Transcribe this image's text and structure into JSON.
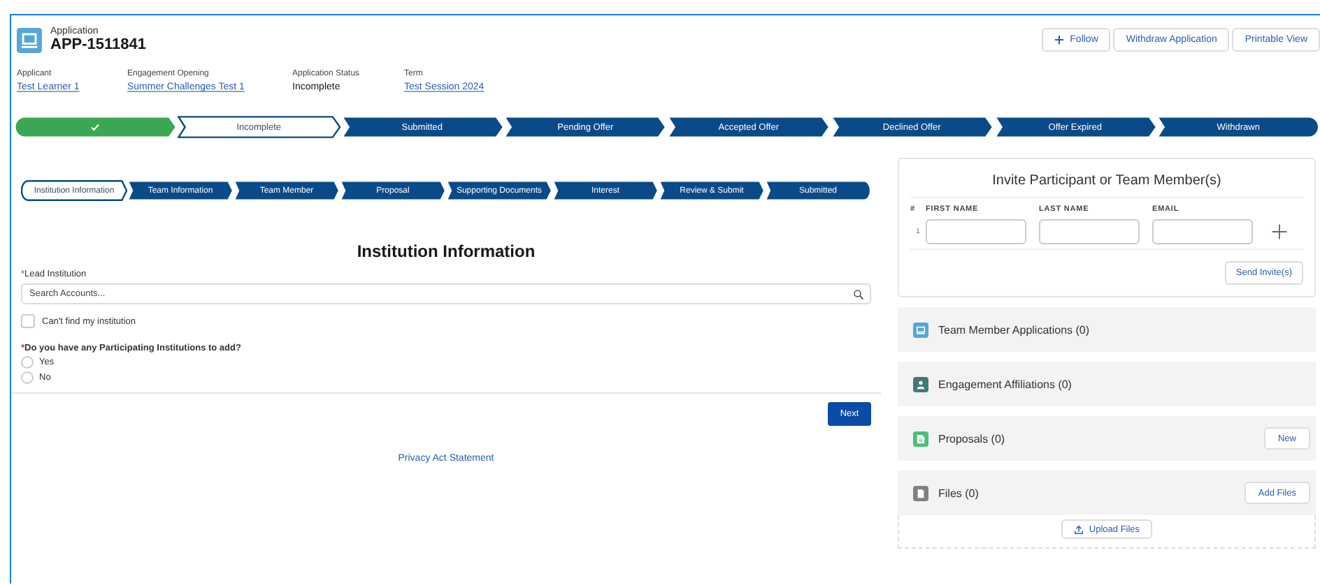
{
  "header": {
    "object_type": "Application",
    "record_name": "APP-1511841",
    "actions": [
      {
        "label": "Follow",
        "kind": "follow"
      },
      {
        "label": "Withdraw Application",
        "kind": "plain"
      },
      {
        "label": "Printable View",
        "kind": "plain"
      }
    ],
    "fields": [
      {
        "label": "Applicant",
        "value": "Test Learner 1",
        "link": true
      },
      {
        "label": "Engagement Opening",
        "value": "Summer Challenges Test 1",
        "link": true
      },
      {
        "label": "Application Status",
        "value": "Incomplete",
        "link": false
      },
      {
        "label": "Term",
        "value": "Test Session 2024",
        "link": true
      }
    ]
  },
  "status_path": [
    {
      "completed": true,
      "selected": false
    },
    {
      "label": "Incomplete",
      "completed": false,
      "selected": true
    },
    {
      "label": "Submitted",
      "completed": false,
      "selected": false
    },
    {
      "label": "Pending Offer",
      "completed": false,
      "selected": false
    },
    {
      "label": "Accepted Offer",
      "completed": false,
      "selected": false
    },
    {
      "label": "Declined Offer",
      "completed": false,
      "selected": false
    },
    {
      "label": "Offer Expired",
      "completed": false,
      "selected": false
    },
    {
      "label": "Withdrawn",
      "completed": false,
      "selected": false
    }
  ],
  "form_steps": [
    {
      "label": "Institution Information",
      "completed": false,
      "selected": true
    },
    {
      "label": "Team Information",
      "completed": false,
      "selected": false
    },
    {
      "label": "Team Member",
      "completed": false,
      "selected": false
    },
    {
      "label": "Proposal",
      "completed": false,
      "selected": false
    },
    {
      "label": "Supporting Documents",
      "completed": false,
      "selected": false
    },
    {
      "label": "Interest",
      "completed": false,
      "selected": false
    },
    {
      "label": "Review & Submit",
      "completed": false,
      "selected": false
    },
    {
      "label": "Submitted",
      "completed": false,
      "selected": false
    }
  ],
  "form": {
    "title": "Institution Information",
    "lead_institution": {
      "label": "Lead Institution",
      "required_mark": "*",
      "placeholder": "Search Accounts..."
    },
    "checkbox": {
      "label": "Can't find my institution",
      "checked": false
    },
    "question": {
      "label": "Do you have any Participating Institutions to add?",
      "required_mark": "*"
    },
    "options": [
      {
        "label": "Yes",
        "selected": false
      },
      {
        "label": "No",
        "selected": false
      }
    ],
    "next_button": "Next",
    "footer_link": "Privacy Act Statement"
  },
  "invite": {
    "title": "Invite Participant or Team Member(s)",
    "columns": [
      "#",
      "FIRST NAME",
      "LAST NAME",
      "EMAIL"
    ],
    "rows": [
      {
        "number": "1"
      }
    ],
    "send_button": "Send Invite(s)"
  },
  "related": [
    {
      "title": "Team Member Applications (0)",
      "kind": "applications",
      "color": "#54a8d6"
    },
    {
      "title": "Engagement Affiliations (0)",
      "kind": "affiliations",
      "color": "#3f7b7a"
    },
    {
      "title": "Proposals (0)",
      "kind": "proposals",
      "color": "#4bc076",
      "button": "New"
    },
    {
      "title": "Files (0)",
      "kind": "files",
      "color": "#808080",
      "button": "Add Files",
      "upload": "Upload Files"
    }
  ]
}
